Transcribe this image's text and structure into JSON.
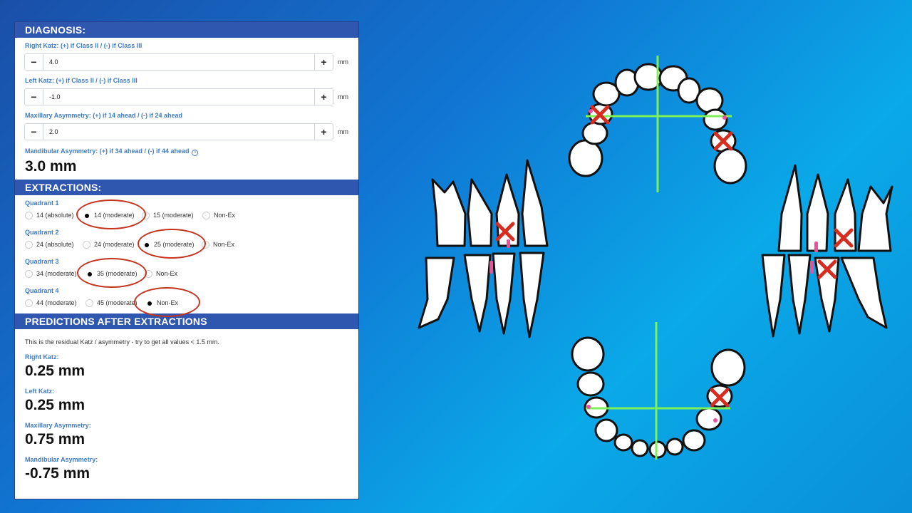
{
  "diagnosis": {
    "header": "DIAGNOSIS:",
    "right_katz": {
      "label": "Right Katz: (+) if Class II / (-) if Class III",
      "value": "4.0",
      "unit": "mm"
    },
    "left_katz": {
      "label": "Left Katz: (+) if Class II / (-) if Class III",
      "value": "-1.0",
      "unit": "mm"
    },
    "max_asym": {
      "label": "Maxillary Asymmetry: (+) if 14 ahead / (-) if 24 ahead",
      "value": "2.0",
      "unit": "mm"
    },
    "mand_asym": {
      "label": "Mandibular Asymmetry: (+) if 34 ahead / (-) if 44 ahead",
      "value": "3.0 mm"
    },
    "minus": "−",
    "plus": "+",
    "info": "i"
  },
  "extractions": {
    "header": "EXTRACTIONS:",
    "q1": {
      "label": "Quadrant 1",
      "options": [
        "14 (absolute)",
        "14 (moderate)",
        "15 (moderate)",
        "Non-Ex"
      ],
      "selected": "14 (moderate)"
    },
    "q2": {
      "label": "Quadrant 2",
      "options": [
        "24 (absolute)",
        "24 (moderate)",
        "25 (moderate)",
        "Non-Ex"
      ],
      "selected": "25 (moderate)"
    },
    "q3": {
      "label": "Quadrant 3",
      "options": [
        "34 (moderate)",
        "35 (moderate)",
        "Non-Ex"
      ],
      "selected": "35 (moderate)"
    },
    "q4": {
      "label": "Quadrant 4",
      "options": [
        "44 (moderate)",
        "45 (moderate)",
        "Non-Ex"
      ],
      "selected": "Non-Ex"
    }
  },
  "predictions": {
    "header": "PREDICTIONS AFTER EXTRACTIONS",
    "note": "This is the residual Katz / asymmetry - try to get all values < 1.5 mm.",
    "right_katz": {
      "label": "Right Katz:",
      "value": "0.25 mm"
    },
    "left_katz": {
      "label": "Left Katz:",
      "value": "0.25 mm"
    },
    "max_asym": {
      "label": "Maxillary Asymmetry:",
      "value": "0.75 mm"
    },
    "mand_asym": {
      "label": "Mandibular Asymmetry:",
      "value": "-0.75 mm"
    }
  },
  "colors": {
    "header_blue": "#2f57b0",
    "label_blue": "#3f7cc4",
    "highlight_red": "#c6331f",
    "midline_green": "#7ef05a",
    "contact_pink": "#ee4f9a"
  }
}
